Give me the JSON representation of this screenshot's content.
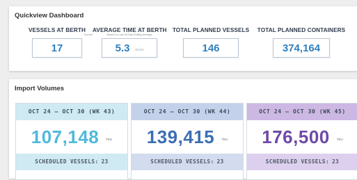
{
  "quickview": {
    "title": "Quickview Dashboard",
    "metrics": [
      {
        "label": "VESSELS AT BERTH",
        "sub": "Current",
        "value": "17",
        "unit": ""
      },
      {
        "label": "AVERAGE TIME AT BERTH",
        "sub": "Based on Last 30-Day Rolling Average",
        "value": "5.3",
        "unit": "DAYS"
      },
      {
        "label": "TOTAL PLANNED VESSELS",
        "sub": "",
        "value": "146",
        "unit": ""
      },
      {
        "label": "TOTAL PLANNED CONTAINERS",
        "sub": "",
        "value": "374,164",
        "unit": ""
      }
    ]
  },
  "import_volumes": {
    "title": "Import Volumes",
    "cards": [
      {
        "week": "OCT 24 – OCT 30 (WK 43)",
        "value": "107,148",
        "unit": "TEU",
        "scheduled_label": "SCHEDULED VESSELS:",
        "scheduled_count": "23",
        "head_color": "#cfeaf3",
        "value_color": "#4fb9dc",
        "foot_color": "#cfeaf3"
      },
      {
        "week": "OCT 24 – OCT 30 (WK 44)",
        "value": "139,415",
        "unit": "TEU",
        "scheduled_label": "SCHEDULED VESSELS:",
        "scheduled_count": "23",
        "head_color": "#c3d2ea",
        "value_color": "#3b6fb3",
        "foot_color": "#d2dcee"
      },
      {
        "week": "OCT 24 – OCT 30 (WK 45)",
        "value": "176,500",
        "unit": "TEU",
        "scheduled_label": "SCHEDULED VESSELS:",
        "scheduled_count": "23",
        "head_color": "#cdb8e3",
        "value_color": "#6e4aa6",
        "foot_color": "#ddd0ee"
      }
    ]
  }
}
